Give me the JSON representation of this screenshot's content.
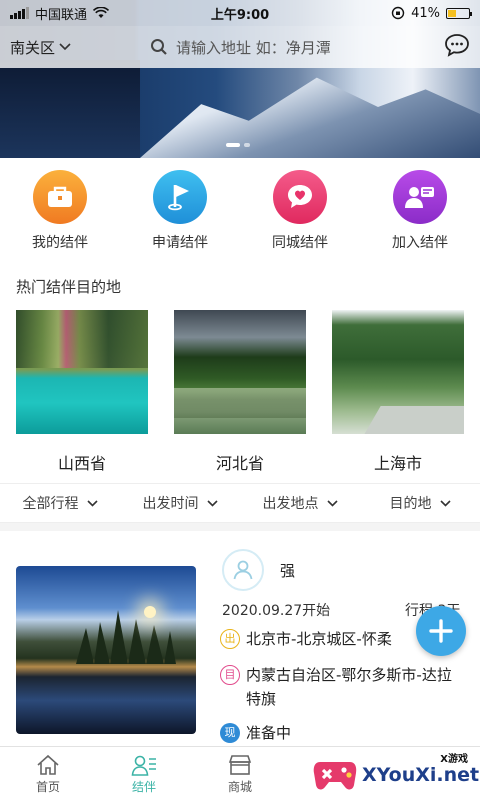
{
  "status_bar": {
    "carrier": "中国联通",
    "time": "上午9:00",
    "battery": "41%",
    "battery_level": 0.41
  },
  "header": {
    "city": "南关区",
    "search_placeholder": "请输入地址  如：净月潭"
  },
  "banner": {
    "page_count": 2,
    "active_index": 0
  },
  "quick_menu": [
    {
      "label": "我的结伴",
      "icon": "bag-icon",
      "color": "#f79631"
    },
    {
      "label": "申请结伴",
      "icon": "flag-icon",
      "color": "#2fa7e3"
    },
    {
      "label": "同城结伴",
      "icon": "chat-heart-icon",
      "color": "#ec3a74"
    },
    {
      "label": "加入结伴",
      "icon": "user-card-icon",
      "color": "#a338d6"
    }
  ],
  "hot": {
    "title": "热门结伴目的地",
    "destinations": [
      {
        "name": "山西省"
      },
      {
        "name": "河北省"
      },
      {
        "name": "上海市"
      }
    ]
  },
  "filters": [
    {
      "label": "全部行程"
    },
    {
      "label": "出发时间"
    },
    {
      "label": "出发地点"
    },
    {
      "label": "目的地"
    }
  ],
  "trip": {
    "user_name": "强",
    "start": "2020.09.27开始",
    "days": "行程 3天",
    "origin_badge": "出",
    "origin": "北京市-北京城区-怀柔",
    "dest_badge": "目",
    "destination": "内蒙古自治区-鄂尔多斯市-达拉特旗",
    "status_badge": "现",
    "status": "准备中"
  },
  "tabbar": [
    {
      "label": "首页",
      "icon": "home-icon",
      "active": false
    },
    {
      "label": "结伴",
      "icon": "companion-icon",
      "active": true
    },
    {
      "label": "商城",
      "icon": "store-icon",
      "active": false
    },
    {
      "label": "",
      "icon": "",
      "active": false
    },
    {
      "label": "",
      "icon": "",
      "active": false
    }
  ],
  "watermark": {
    "text": "XYouXi.net",
    "tag": "X游戏"
  },
  "colors": {
    "accent": "#3bb3a6",
    "fab": "#3da8e6"
  }
}
